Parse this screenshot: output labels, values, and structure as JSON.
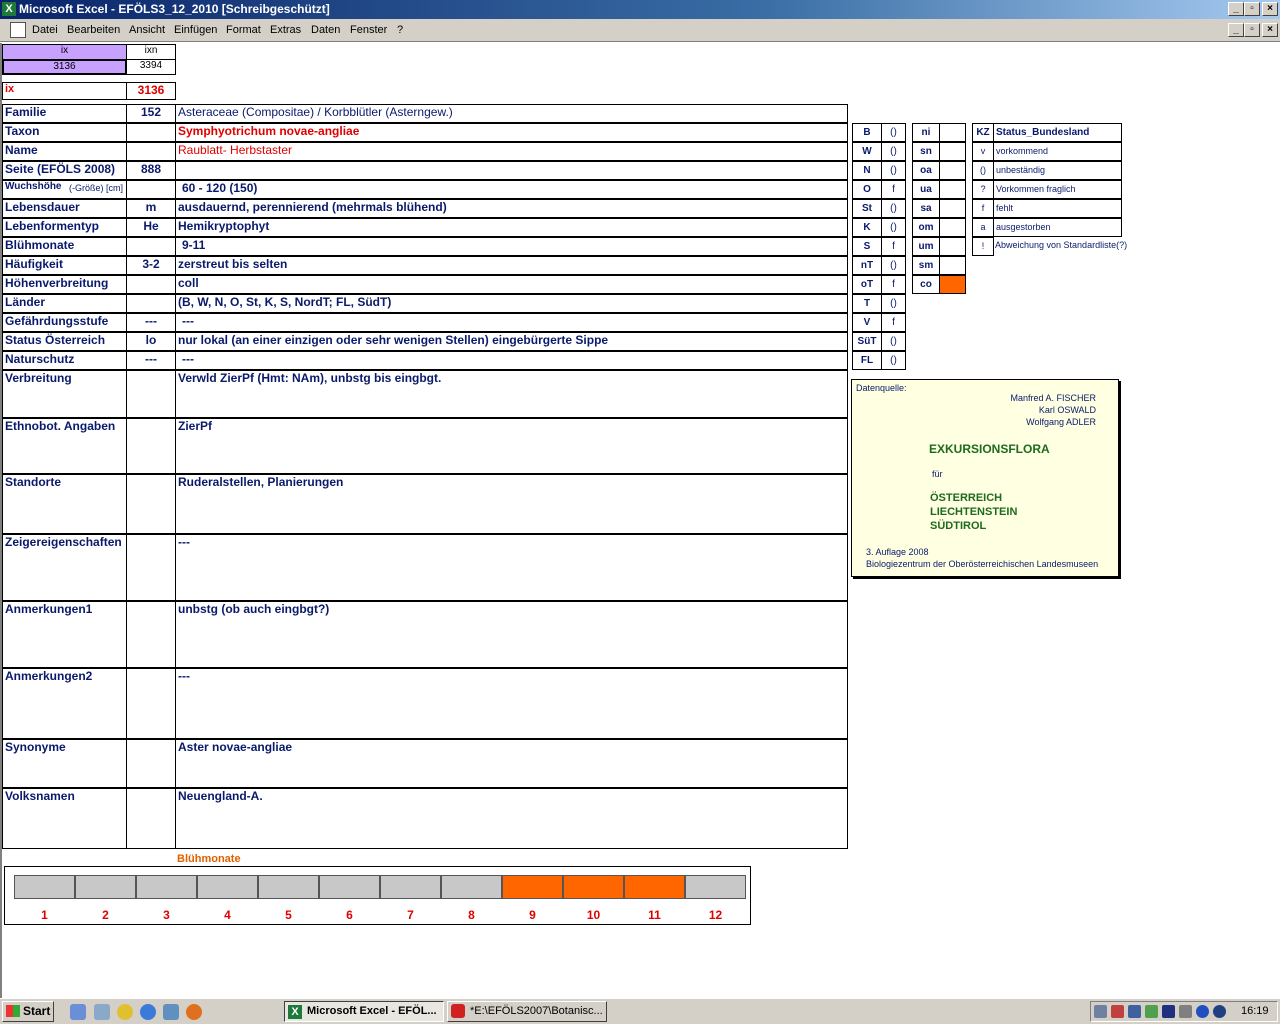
{
  "window": {
    "title": "Microsoft Excel - EFÖLS3_12_2010  [Schreibgeschützt]"
  },
  "menu": [
    "Datei",
    "Bearbeiten",
    "Ansicht",
    "Einfügen",
    "Format",
    "Extras",
    "Daten",
    "Fenster",
    "?"
  ],
  "index": {
    "ix_label": "ix",
    "ixn_label": "ixn",
    "ix_value": "3136",
    "ixn_value": "3394",
    "ix2_label": "ix",
    "ix2_value": "3136"
  },
  "rows": [
    {
      "label": "Familie",
      "code": "152",
      "value": "Asteraceae (Compositae)  /  Korbblütler (Asterngew.)"
    },
    {
      "label": "Taxon",
      "code": "",
      "value": "Symphyotrichum novae-angliae"
    },
    {
      "label": "Name",
      "code": "",
      "value": "Raublatt- Herbstaster"
    },
    {
      "label": "Seite (EFÖLS 2008)",
      "code": "888",
      "value": ""
    },
    {
      "label": "Wuchshöhe",
      "label_suffix": "(-Größe) [cm]",
      "code": "",
      "value": "60 - 120 (150)"
    },
    {
      "label": "Lebensdauer",
      "code": "m",
      "value": "ausdauernd, perennierend (mehrmals blühend)"
    },
    {
      "label": "Lebenformentyp",
      "code": "He",
      "value": "Hemikryptophyt"
    },
    {
      "label": "Blühmonate",
      "code": "",
      "value": "9-11"
    },
    {
      "label": "Häufigkeit",
      "code": "3-2",
      "value": "zerstreut bis selten"
    },
    {
      "label": "Höhenverbreitung",
      "code": "",
      "value": "coll"
    },
    {
      "label": "Länder",
      "code": "",
      "value": "(B, W, N, O, St, K, S, NordT; FL, SüdT)"
    },
    {
      "label": "Gefährdungsstufe",
      "code": "---",
      "value": "---"
    },
    {
      "label": "Status Österreich",
      "code": "lo",
      "value": "nur lokal (an einer einzigen oder sehr wenigen Stellen) eingebürgerte Sippe"
    },
    {
      "label": "Naturschutz",
      "code": "---",
      "value": "---"
    },
    {
      "label": "Verbreitung",
      "code": "",
      "value": "Verwld ZierPf (Hmt: NAm), unbstg bis eingbgt."
    },
    {
      "label": "Ethnobot. Angaben",
      "code": "",
      "value": "ZierPf"
    },
    {
      "label": "Standorte",
      "code": "",
      "value": "Ruderalstellen, Planierungen"
    },
    {
      "label": "Zeigereigenschaften",
      "code": "",
      "value": "---"
    },
    {
      "label": "Anmerkungen1",
      "code": "",
      "value": "unbstg (ob auch eingbgt?)"
    },
    {
      "label": "Anmerkungen2",
      "code": "",
      "value": "---"
    },
    {
      "label": "Synonyme",
      "code": "",
      "value": "Aster novae-angliae"
    },
    {
      "label": "Volksnamen",
      "code": "",
      "value": "Neuengland-A."
    }
  ],
  "regions": [
    {
      "code": "B",
      "status": "()"
    },
    {
      "code": "W",
      "status": "()"
    },
    {
      "code": "N",
      "status": "()"
    },
    {
      "code": "O",
      "status": "f"
    },
    {
      "code": "St",
      "status": "()"
    },
    {
      "code": "K",
      "status": "()"
    },
    {
      "code": "S",
      "status": "f"
    },
    {
      "code": "nT",
      "status": "()"
    },
    {
      "code": "oT",
      "status": "f"
    },
    {
      "code": "T",
      "status": "()"
    },
    {
      "code": "V",
      "status": "f"
    },
    {
      "code": "SüT",
      "status": "()"
    },
    {
      "code": "FL",
      "status": "()"
    }
  ],
  "altitude": [
    "ni",
    "sn",
    "oa",
    "ua",
    "sa",
    "om",
    "um",
    "sm",
    "co"
  ],
  "altitude_highlight_color": "#ff6600",
  "status_legend": {
    "header_code": "KZ",
    "header_label": "Status_Bundesland",
    "items": [
      {
        "code": "v",
        "label": "vorkommend"
      },
      {
        "code": "()",
        "label": "unbeständig"
      },
      {
        "code": "?",
        "label": "Vorkommen fraglich"
      },
      {
        "code": "f",
        "label": "fehlt"
      },
      {
        "code": "a",
        "label": "ausgestorben"
      },
      {
        "code": "!",
        "label": "Abweichung von Standardliste(?)"
      }
    ]
  },
  "source": {
    "title": "Datenquelle:",
    "authors": [
      "Manfred A. FISCHER",
      "Karl OSWALD",
      "Wolfgang ADLER"
    ],
    "book": "EXKURSIONSFLORA",
    "fuer": "für",
    "countries": [
      "ÖSTERREICH",
      "LIECHTENSTEIN",
      "SÜDTIROL"
    ],
    "edition": "3. Auflage 2008",
    "publisher": "Biologiezentrum der Oberösterreichischen Landesmuseen"
  },
  "bloom": {
    "title": "Blühmonate",
    "months": [
      "1",
      "2",
      "3",
      "4",
      "5",
      "6",
      "7",
      "8",
      "9",
      "10",
      "11",
      "12"
    ],
    "flowering": [
      false,
      false,
      false,
      false,
      false,
      false,
      false,
      false,
      true,
      true,
      true,
      false
    ]
  },
  "taskbar": {
    "start": "Start",
    "tasks": [
      "Microsoft Excel - EFÖL...",
      "*E:\\EFÖLS2007\\Botanisc..."
    ],
    "clock": "16:19"
  }
}
